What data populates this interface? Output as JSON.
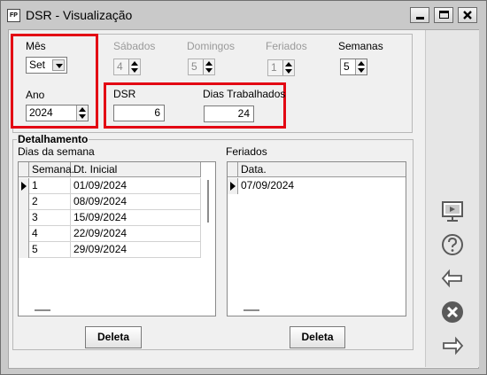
{
  "window": {
    "title": "DSR - Visualização",
    "app_icon": "FP"
  },
  "filters": {
    "mes_label": "Mês",
    "mes_value": "Set",
    "ano_label": "Ano",
    "ano_value": "2024",
    "sabados_label": "Sábados",
    "sabados_value": "4",
    "domingos_label": "Domingos",
    "domingos_value": "5",
    "feriados_label": "Feriados",
    "feriados_value": "1",
    "semanas_label": "Semanas",
    "semanas_value": "5",
    "dsr_label": "DSR",
    "dsr_value": "6",
    "dias_trab_label": "Dias Trabalhados",
    "dias_trab_value": "24"
  },
  "detalhamento": {
    "title": "Detalhamento",
    "dias_semana_label": "Dias da semana",
    "feriados_label": "Feriados",
    "weeks_columns": [
      "Semana.",
      "Dt. Inicial"
    ],
    "weeks": [
      {
        "semana": "1",
        "inicial": "01/09/2024"
      },
      {
        "semana": "2",
        "inicial": "08/09/2024"
      },
      {
        "semana": "3",
        "inicial": "15/09/2024"
      },
      {
        "semana": "4",
        "inicial": "22/09/2024"
      },
      {
        "semana": "5",
        "inicial": "29/09/2024"
      }
    ],
    "holidays_columns": [
      "Data."
    ],
    "holidays": [
      "07/09/2024"
    ],
    "delete_label": "Deleta"
  },
  "sidebar": {
    "icons": [
      "screen-icon",
      "help-icon",
      "back-arrow-icon",
      "cancel-icon",
      "forward-arrow-icon"
    ]
  },
  "colors": {
    "highlight": "#e30613",
    "panel": "#f0f0f0",
    "frame": "#c9c9c9"
  }
}
